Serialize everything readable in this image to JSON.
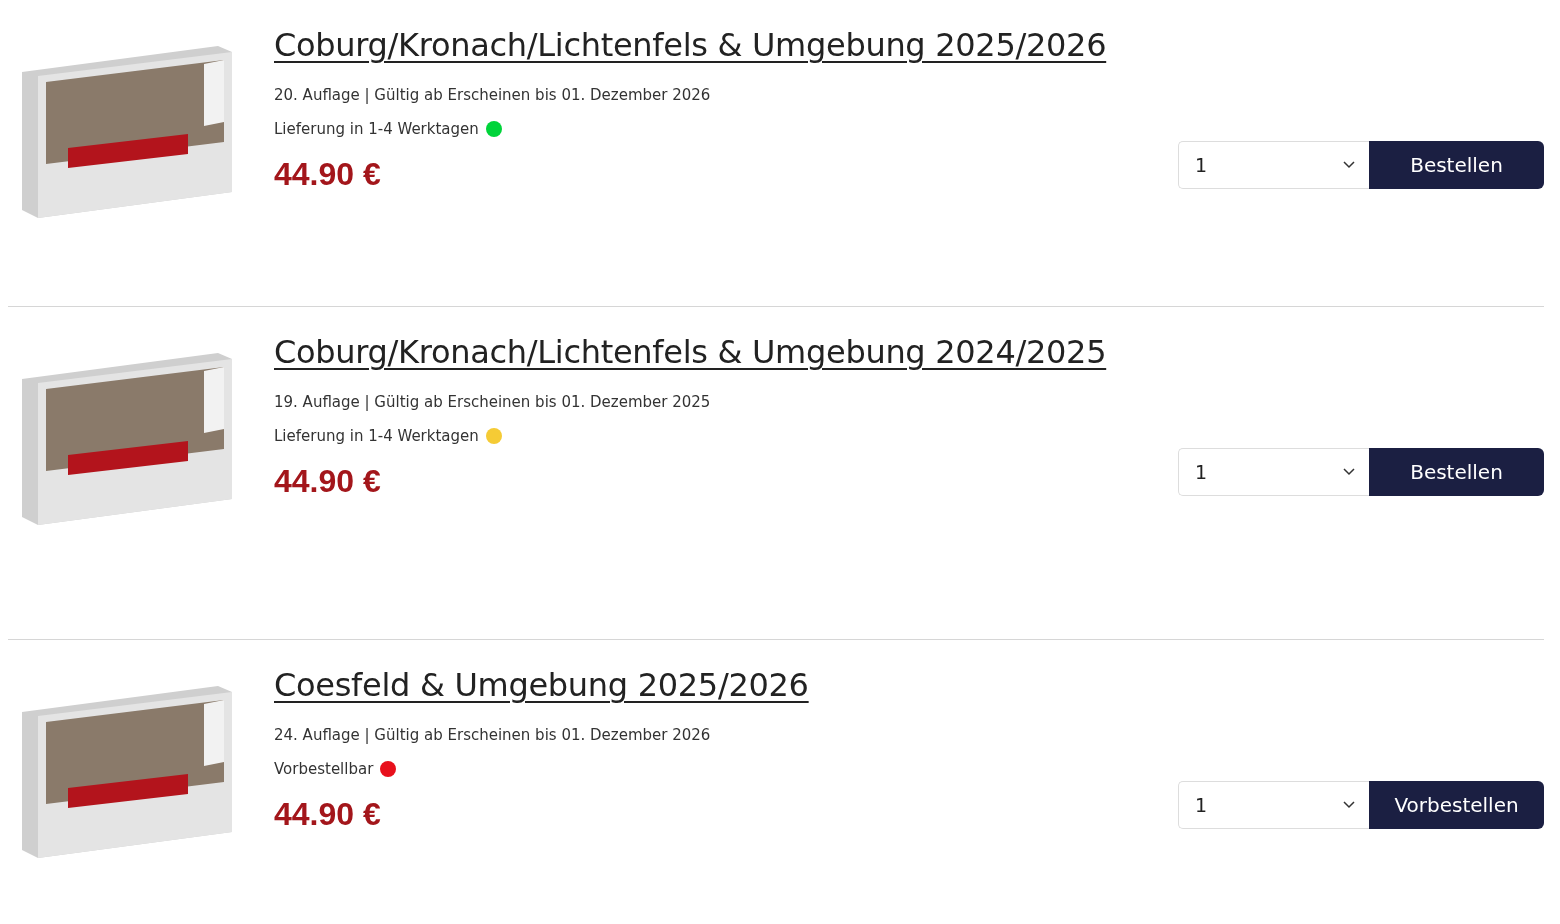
{
  "products": [
    {
      "title": "Coburg/Kronach/Lichtenfels & Umgebung 2025/2026",
      "edition": "20. Auflage | Gültig ab Erscheinen bis 01. Dezember 2026",
      "availability": {
        "label": "Lieferung in 1-4 Werktagen",
        "color": "#00d43a"
      },
      "price": "44.90 €",
      "quantity": "1",
      "button": "Bestellen"
    },
    {
      "title": "Coburg/Kronach/Lichtenfels & Umgebung 2024/2025",
      "edition": "19. Auflage | Gültig ab Erscheinen bis 01. Dezember 2025",
      "availability": {
        "label": "Lieferung in 1-4 Werktagen",
        "color": "#f5cb35"
      },
      "price": "44.90 €",
      "quantity": "1",
      "button": "Bestellen"
    },
    {
      "title": "Coesfeld & Umgebung 2025/2026",
      "edition": "24. Auflage | Gültig ab Erscheinen bis 01. Dezember 2026",
      "availability": {
        "label": "Vorbestellbar",
        "color": "#e8101c"
      },
      "price": "44.90 €",
      "quantity": "1",
      "button": "Vorbestellen"
    }
  ]
}
